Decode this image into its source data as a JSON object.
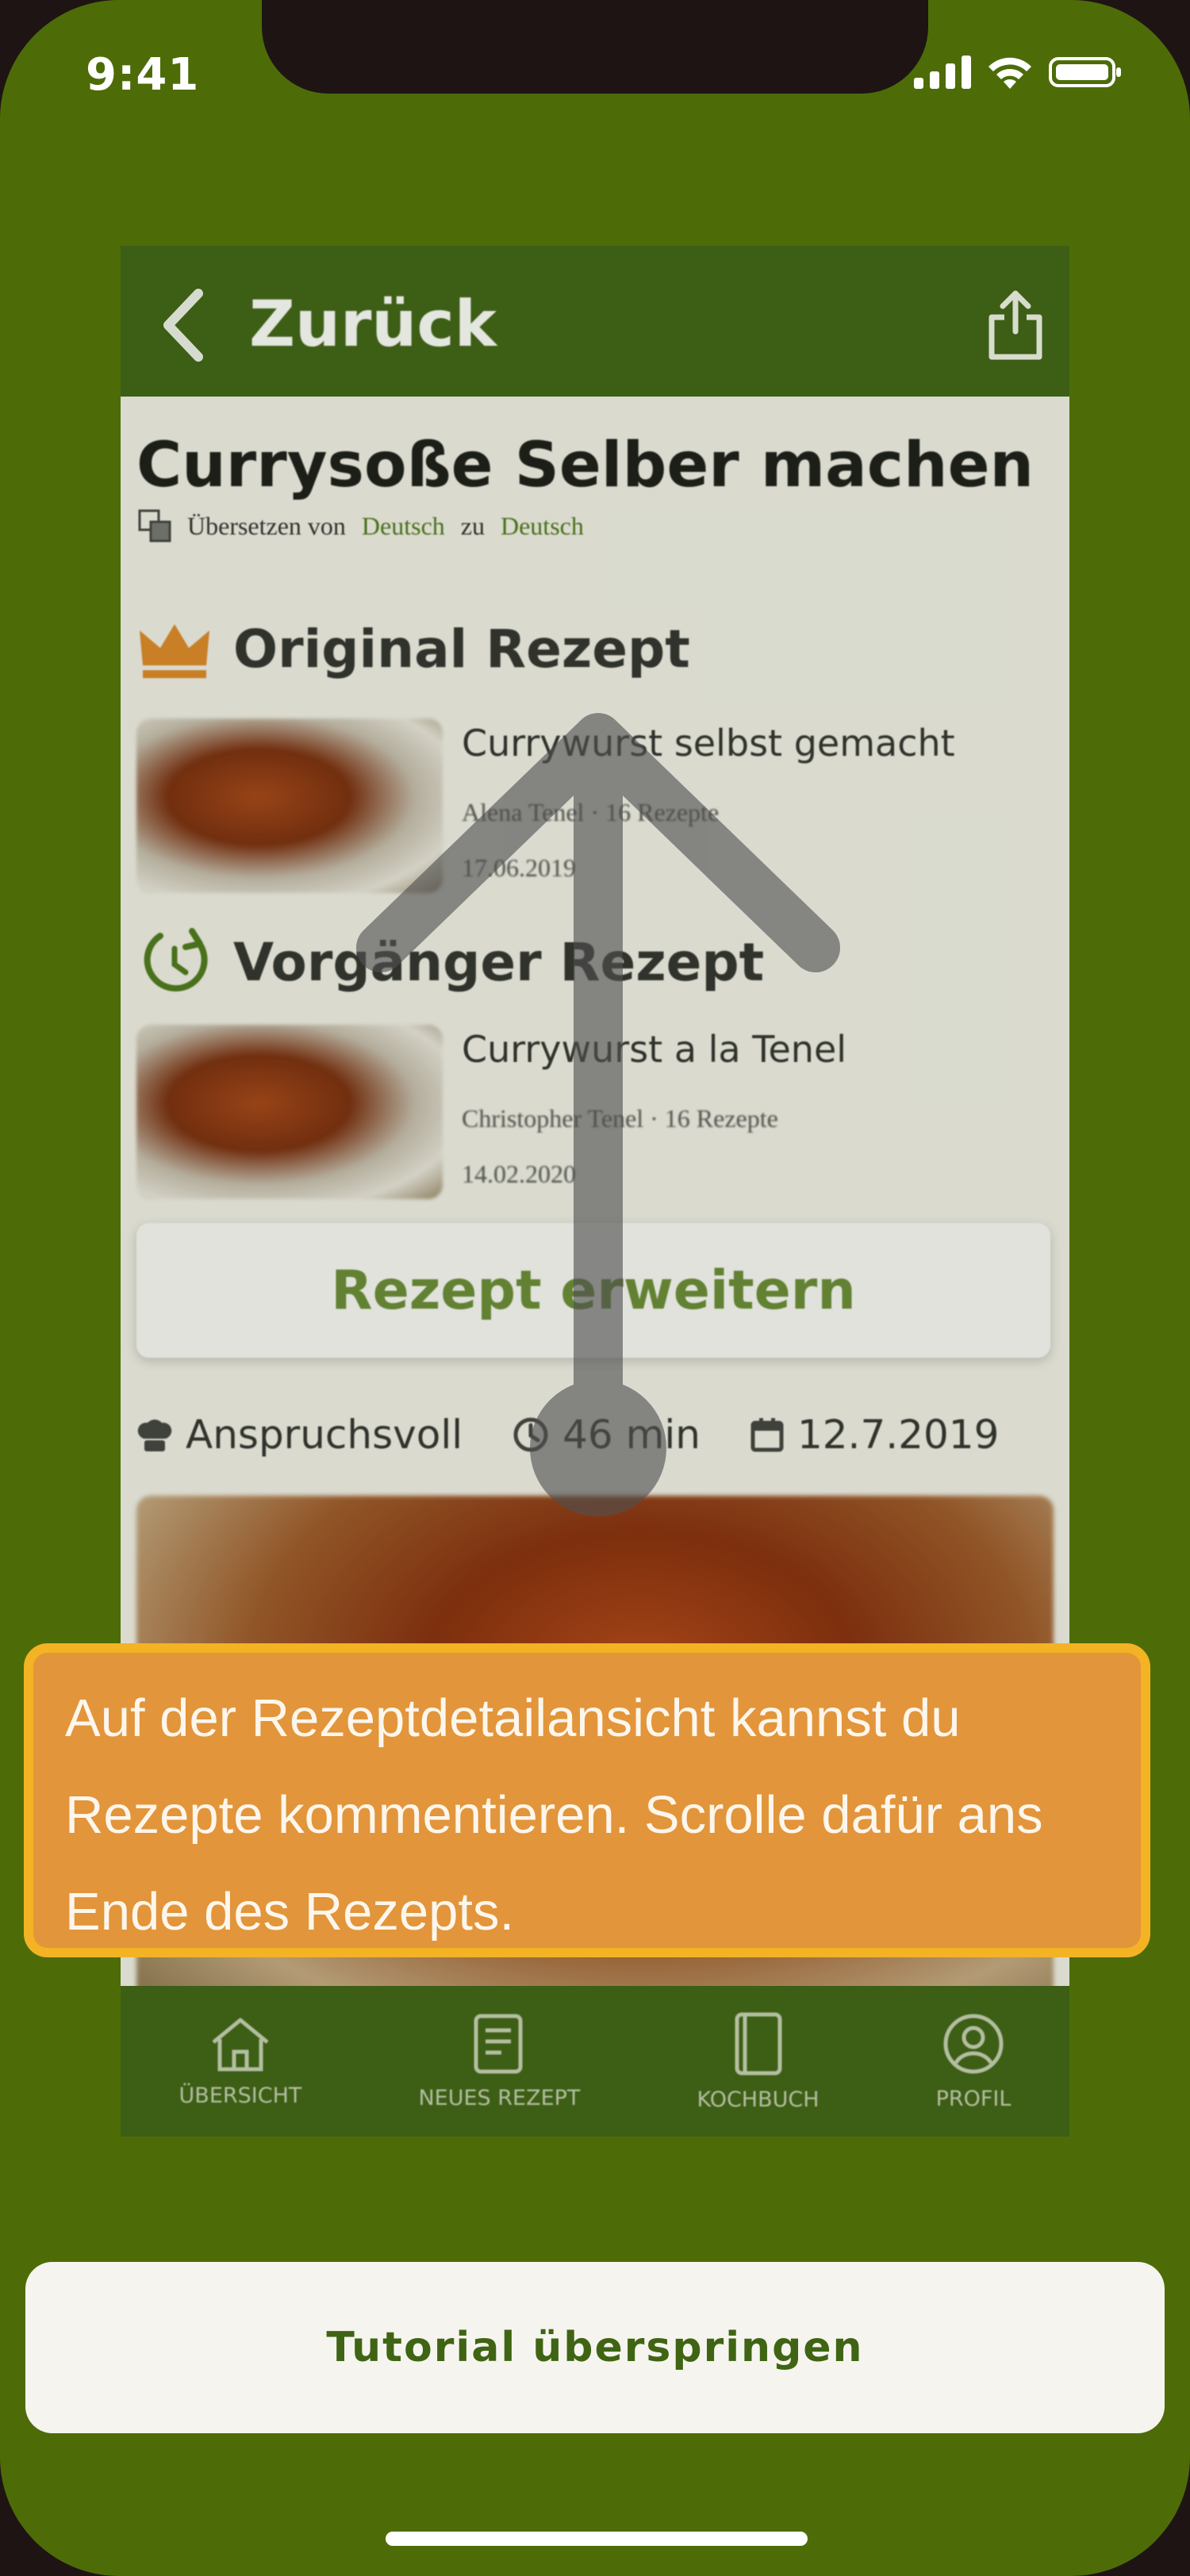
{
  "status_bar": {
    "time": "9:41"
  },
  "header": {
    "back_label": "Zurück"
  },
  "recipe": {
    "title": "Currysoße Selber machen",
    "translation": {
      "prefix": "Übersetzen von",
      "from": "Deutsch",
      "connector": "zu",
      "to": "Deutsch"
    },
    "original": {
      "heading": "Original Rezept",
      "title": "Currywurst selbst gemacht",
      "author": "Alena Tenel · 16 Rezepte",
      "date": "17.06.2019"
    },
    "predecessor": {
      "heading": "Vorgänger Rezept",
      "title": "Currywurst a la Tenel",
      "author": "Christopher Tenel · 16 Rezepte",
      "date": "14.02.2020"
    },
    "extend_button": "Rezept erweitern",
    "info": {
      "difficulty": "Anspruchsvoll",
      "duration": "46 min",
      "date": "12.7.2019"
    }
  },
  "tab_bar": {
    "items": [
      {
        "label": "ÜBERSICHT",
        "icon": "house-icon"
      },
      {
        "label": "NEUES REZEPT",
        "icon": "document-icon"
      },
      {
        "label": "KOCHBUCH",
        "icon": "book-icon"
      },
      {
        "label": "PROFIL",
        "icon": "person-icon"
      }
    ]
  },
  "tutorial": {
    "hint_line1": "Auf der Rezeptdetailansicht kannst du",
    "hint_line2": "Rezepte kommentieren. Scrolle dafür ans",
    "hint_line3": "Ende des Rezepts.",
    "skip_button": "Tutorial überspringen",
    "gesture": "swipe-up-arrow-icon"
  },
  "colors": {
    "background_green": "#4d6c08",
    "header_green": "#416519",
    "tooltip_orange": "#e2953a",
    "tooltip_border": "#f3b324",
    "accent_text": "#3f6413"
  }
}
